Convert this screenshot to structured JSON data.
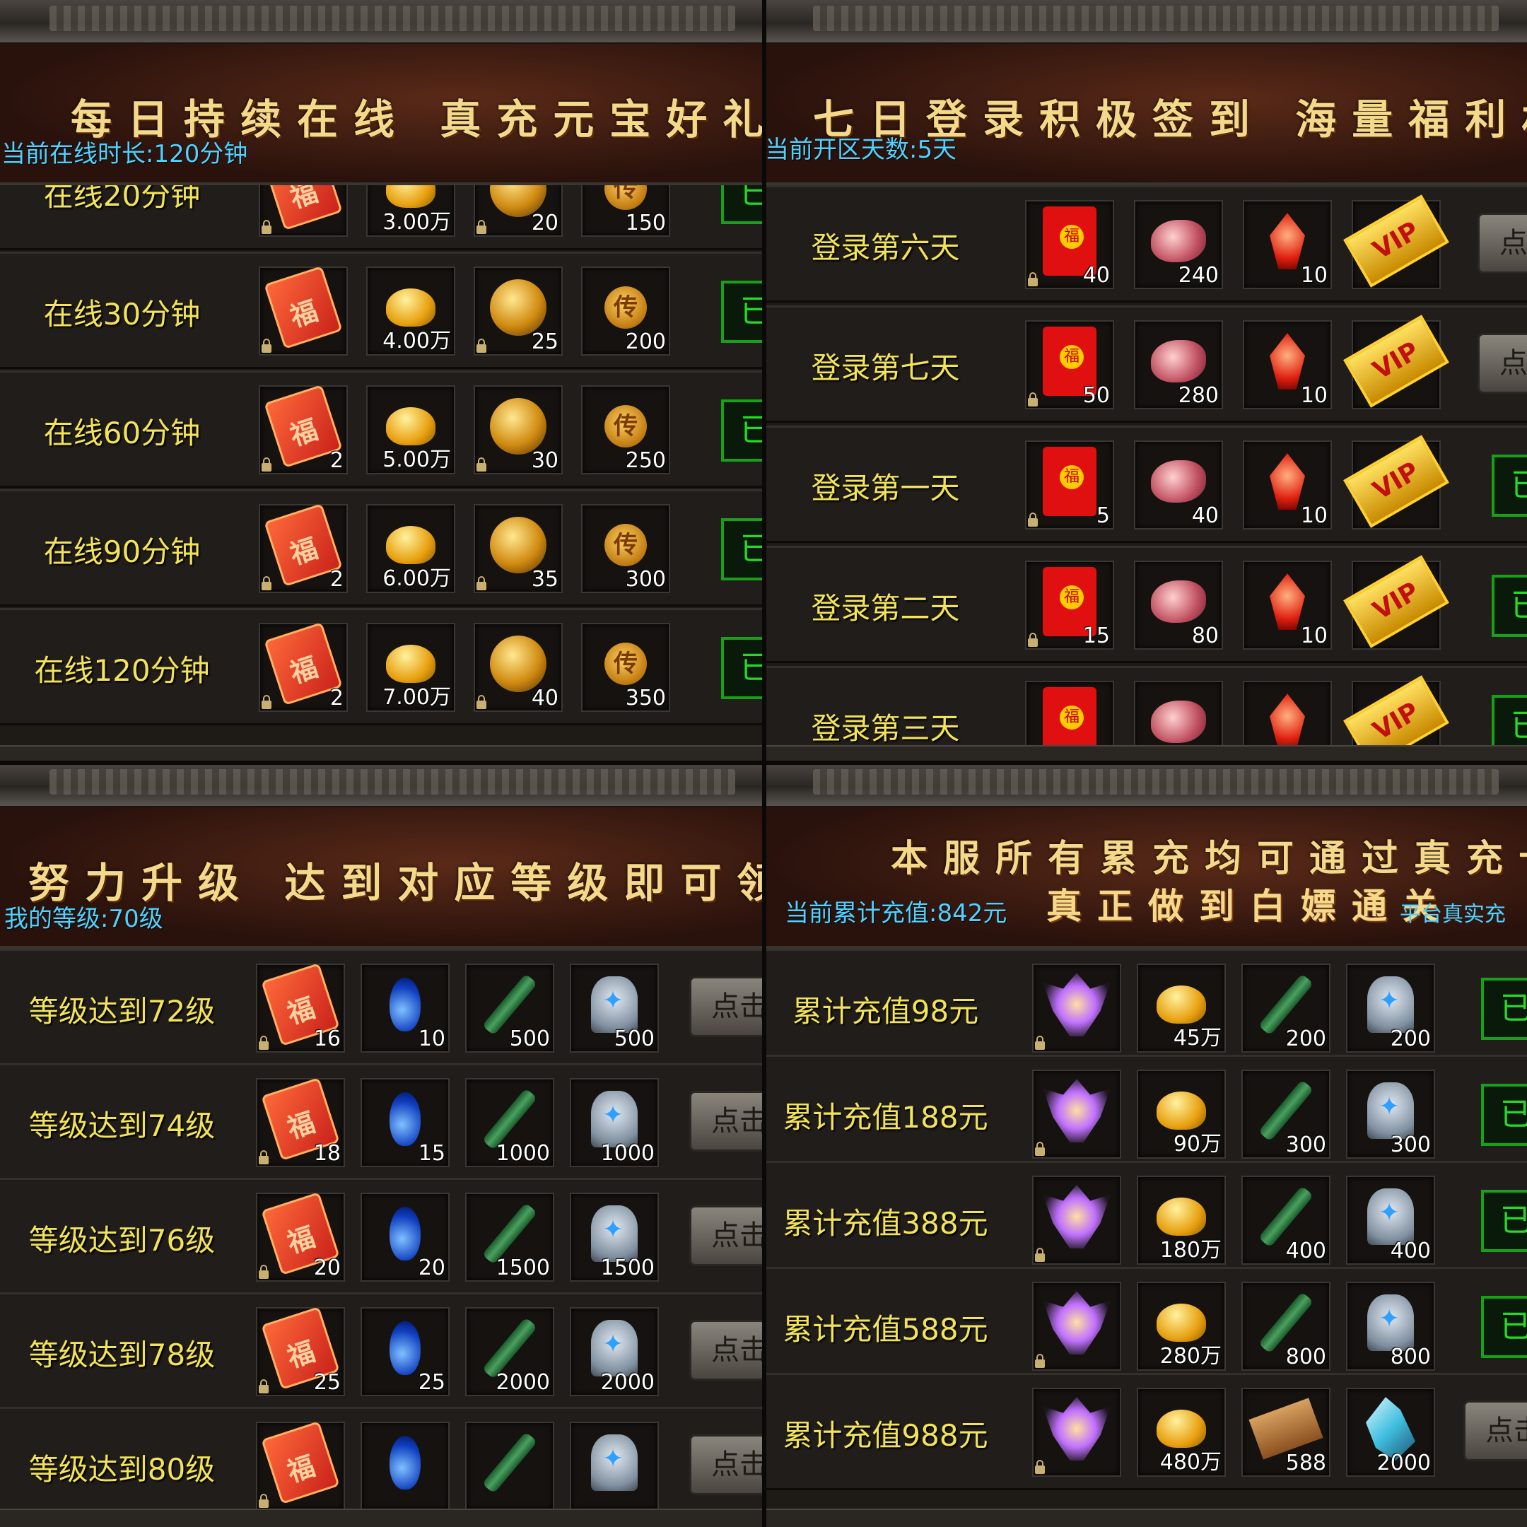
{
  "panel_online": {
    "slogan": "每日持续在线 真充元宝好礼奖励",
    "info_label": "当前在线时长:",
    "info_value": "120分钟",
    "button_text": "已",
    "rows": [
      {
        "label": "在线20分钟",
        "items": [
          {
            "icon": "red-packet-icon",
            "count": ""
          },
          {
            "icon": "gold-ingot-icon",
            "count": "3.00万"
          },
          {
            "icon": "golden-orb-icon",
            "count": "20"
          },
          {
            "icon": "legend-coin-icon",
            "count": "150"
          }
        ]
      },
      {
        "label": "在线30分钟",
        "items": [
          {
            "icon": "red-packet-icon",
            "count": ""
          },
          {
            "icon": "gold-ingot-icon",
            "count": "4.00万"
          },
          {
            "icon": "golden-orb-icon",
            "count": "25"
          },
          {
            "icon": "legend-coin-icon",
            "count": "200"
          }
        ]
      },
      {
        "label": "在线60分钟",
        "items": [
          {
            "icon": "red-packet-icon",
            "count": "2"
          },
          {
            "icon": "gold-ingot-icon",
            "count": "5.00万"
          },
          {
            "icon": "golden-orb-icon",
            "count": "30"
          },
          {
            "icon": "legend-coin-icon",
            "count": "250"
          }
        ]
      },
      {
        "label": "在线90分钟",
        "items": [
          {
            "icon": "red-packet-icon",
            "count": "2"
          },
          {
            "icon": "gold-ingot-icon",
            "count": "6.00万"
          },
          {
            "icon": "golden-orb-icon",
            "count": "35"
          },
          {
            "icon": "legend-coin-icon",
            "count": "300"
          }
        ]
      },
      {
        "label": "在线120分钟",
        "items": [
          {
            "icon": "red-packet-icon",
            "count": "2"
          },
          {
            "icon": "gold-ingot-icon",
            "count": "7.00万"
          },
          {
            "icon": "golden-orb-icon",
            "count": "40"
          },
          {
            "icon": "legend-coin-icon",
            "count": "350"
          }
        ]
      }
    ]
  },
  "panel_login": {
    "slogan": "七日登录积极签到 海量福利材料大",
    "info_label": "当前开区天数:",
    "info_value": "5天",
    "button_claim_text": "点",
    "button_done_text": "已",
    "rows": [
      {
        "label": "登录第六天",
        "button": "claim",
        "items": [
          {
            "icon": "red-envelope-icon",
            "count": "40"
          },
          {
            "icon": "meat-icon",
            "count": "240"
          },
          {
            "icon": "red-gem-icon",
            "count": "10"
          },
          {
            "icon": "vip-card-icon",
            "count": ""
          }
        ]
      },
      {
        "label": "登录第七天",
        "button": "claim",
        "items": [
          {
            "icon": "red-envelope-icon",
            "count": "50"
          },
          {
            "icon": "meat-icon",
            "count": "280"
          },
          {
            "icon": "red-gem-icon",
            "count": "10"
          },
          {
            "icon": "vip-card-icon",
            "count": ""
          }
        ]
      },
      {
        "label": "登录第一天",
        "button": "done",
        "items": [
          {
            "icon": "red-envelope-icon",
            "count": "5"
          },
          {
            "icon": "meat-icon",
            "count": "40"
          },
          {
            "icon": "red-gem-icon",
            "count": "10"
          },
          {
            "icon": "vip-card-icon",
            "count": ""
          }
        ]
      },
      {
        "label": "登录第二天",
        "button": "done",
        "items": [
          {
            "icon": "red-envelope-icon",
            "count": "15"
          },
          {
            "icon": "meat-icon",
            "count": "80"
          },
          {
            "icon": "red-gem-icon",
            "count": "10"
          },
          {
            "icon": "vip-card-icon",
            "count": ""
          }
        ]
      },
      {
        "label": "登录第三天",
        "button": "done",
        "items": [
          {
            "icon": "red-envelope-icon",
            "count": ""
          },
          {
            "icon": "meat-icon",
            "count": ""
          },
          {
            "icon": "red-gem-icon",
            "count": ""
          },
          {
            "icon": "vip-card-icon",
            "count": ""
          }
        ]
      }
    ]
  },
  "panel_level": {
    "slogan": "努力升级 达到对应等级即可领取海量",
    "info_label": "我的等级:",
    "info_value": "70级",
    "button_text": "点击",
    "rows": [
      {
        "label": "等级达到72级",
        "items": [
          {
            "icon": "red-packet-icon",
            "count": "16"
          },
          {
            "icon": "blue-potion-icon",
            "count": "10"
          },
          {
            "icon": "green-scroll-icon",
            "count": "500"
          },
          {
            "icon": "rune-stone-icon",
            "count": "500"
          }
        ]
      },
      {
        "label": "等级达到74级",
        "items": [
          {
            "icon": "red-packet-icon",
            "count": "18"
          },
          {
            "icon": "blue-potion-icon",
            "count": "15"
          },
          {
            "icon": "green-scroll-icon",
            "count": "1000"
          },
          {
            "icon": "rune-stone-icon",
            "count": "1000"
          }
        ]
      },
      {
        "label": "等级达到76级",
        "items": [
          {
            "icon": "red-packet-icon",
            "count": "20"
          },
          {
            "icon": "blue-potion-icon",
            "count": "20"
          },
          {
            "icon": "green-scroll-icon",
            "count": "1500"
          },
          {
            "icon": "rune-stone-icon",
            "count": "1500"
          }
        ]
      },
      {
        "label": "等级达到78级",
        "items": [
          {
            "icon": "red-packet-icon",
            "count": "25"
          },
          {
            "icon": "blue-potion-icon",
            "count": "25"
          },
          {
            "icon": "green-scroll-icon",
            "count": "2000"
          },
          {
            "icon": "rune-stone-icon",
            "count": "2000"
          }
        ]
      },
      {
        "label": "等级达到80级",
        "items": [
          {
            "icon": "red-packet-icon",
            "count": ""
          },
          {
            "icon": "blue-potion-icon",
            "count": ""
          },
          {
            "icon": "green-scroll-icon",
            "count": ""
          },
          {
            "icon": "rune-stone-icon",
            "count": ""
          }
        ]
      }
    ]
  },
  "panel_recharge": {
    "slogan": "本服所有累充均可通过真充卡获",
    "slogan2": "真正做到白嫖通关",
    "info_label": "当前累计充值:",
    "info_value": "842元",
    "info_right": "平台真实充",
    "button_done_text": "已",
    "button_claim_text": "点击",
    "rows": [
      {
        "label": "累计充值98元",
        "button": "done",
        "items": [
          {
            "icon": "winged-emblem-icon",
            "count": ""
          },
          {
            "icon": "gold-ingot-icon",
            "count": "45万"
          },
          {
            "icon": "green-scroll-icon",
            "count": "200"
          },
          {
            "icon": "rune-stone-icon",
            "count": "200"
          }
        ]
      },
      {
        "label": "累计充值188元",
        "button": "done",
        "items": [
          {
            "icon": "winged-emblem-icon",
            "count": ""
          },
          {
            "icon": "gold-ingot-icon",
            "count": "90万"
          },
          {
            "icon": "green-scroll-icon",
            "count": "300"
          },
          {
            "icon": "rune-stone-icon",
            "count": "300"
          }
        ]
      },
      {
        "label": "累计充值388元",
        "button": "done",
        "items": [
          {
            "icon": "winged-emblem-icon",
            "count": ""
          },
          {
            "icon": "gold-ingot-icon",
            "count": "180万"
          },
          {
            "icon": "green-scroll-icon",
            "count": "400"
          },
          {
            "icon": "rune-stone-icon",
            "count": "400"
          }
        ]
      },
      {
        "label": "累计充值588元",
        "button": "done",
        "items": [
          {
            "icon": "winged-emblem-icon",
            "count": ""
          },
          {
            "icon": "gold-ingot-icon",
            "count": "280万"
          },
          {
            "icon": "green-scroll-icon",
            "count": "800"
          },
          {
            "icon": "rune-stone-icon",
            "count": "800"
          }
        ]
      },
      {
        "label": "累计充值988元",
        "button": "claim",
        "items": [
          {
            "icon": "winged-emblem-icon",
            "count": ""
          },
          {
            "icon": "gold-ingot-icon",
            "count": "480万"
          },
          {
            "icon": "treasure-map-icon",
            "count": "588"
          },
          {
            "icon": "crystal-shard-icon",
            "count": "2000"
          }
        ]
      }
    ]
  }
}
